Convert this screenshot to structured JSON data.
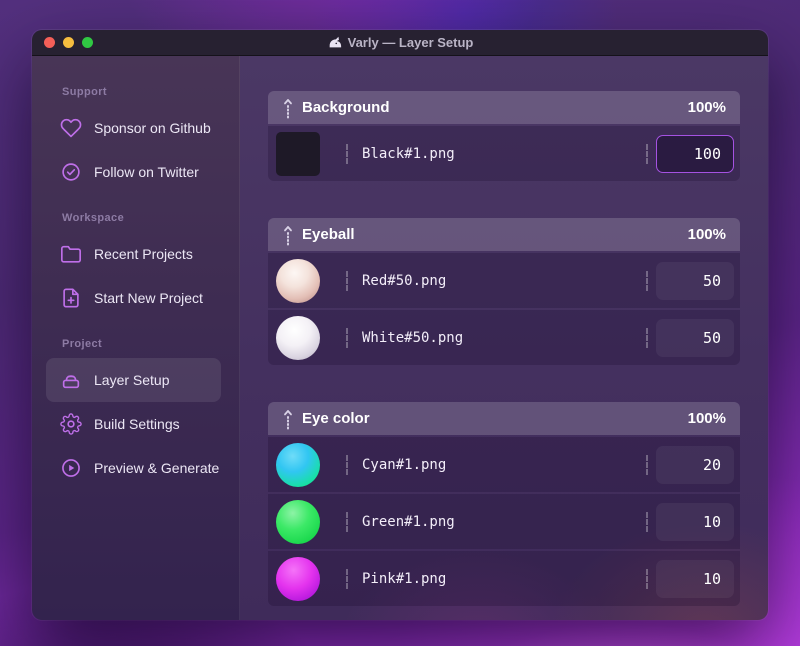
{
  "window": {
    "title": "Varly — Layer Setup",
    "app_icon": "unicorn-icon"
  },
  "colors": {
    "accent": "#a552e2",
    "sidebar_icon": "#bf6fe9",
    "titlebar_bg": "#272131",
    "traffic_red": "#f45f58",
    "traffic_yellow": "#f6bd3f",
    "traffic_green": "#30c843",
    "thumb_black": "#1e1927",
    "thumb_red": "#e3bfb6",
    "thumb_white": "#f4f1f6",
    "thumb_cyan": "#1fd3c0",
    "thumb_green": "#2ce05a",
    "thumb_pink": "#d629e8"
  },
  "sidebar": {
    "sections": [
      {
        "label": "Support",
        "items": [
          {
            "icon": "heart-icon",
            "label": "Sponsor on Github"
          },
          {
            "icon": "badge-check-icon",
            "label": "Follow on Twitter"
          }
        ]
      },
      {
        "label": "Workspace",
        "items": [
          {
            "icon": "folder-icon",
            "label": "Recent Projects"
          },
          {
            "icon": "file-plus-icon",
            "label": "Start New Project"
          }
        ]
      },
      {
        "label": "Project",
        "items": [
          {
            "icon": "layers-icon",
            "label": "Layer Setup",
            "selected": true
          },
          {
            "icon": "gear-icon",
            "label": "Build Settings"
          },
          {
            "icon": "play-circle-icon",
            "label": "Preview & Generate"
          }
        ]
      }
    ]
  },
  "groups": [
    {
      "name": "Background",
      "weight": "100%",
      "layers": [
        {
          "file": "Black#1.png",
          "value": "100",
          "thumb": "black",
          "focused": true
        }
      ]
    },
    {
      "name": "Eyeball",
      "weight": "100%",
      "layers": [
        {
          "file": "Red#50.png",
          "value": "50",
          "thumb": "red"
        },
        {
          "file": "White#50.png",
          "value": "50",
          "thumb": "white"
        }
      ]
    },
    {
      "name": "Eye color",
      "weight": "100%",
      "layers": [
        {
          "file": "Cyan#1.png",
          "value": "20",
          "thumb": "cyan"
        },
        {
          "file": "Green#1.png",
          "value": "10",
          "thumb": "green"
        },
        {
          "file": "Pink#1.png",
          "value": "10",
          "thumb": "pink"
        }
      ]
    }
  ]
}
